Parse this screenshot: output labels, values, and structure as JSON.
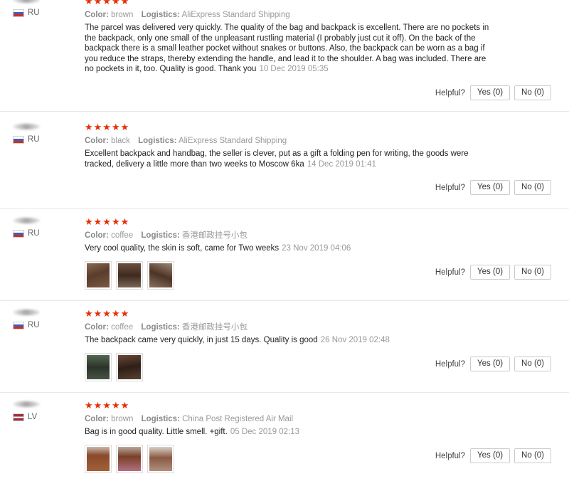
{
  "helpful_label": "Helpful?",
  "star_color": "#e62e04",
  "reviews": [
    {
      "country": "RU",
      "stars": "★★★★★",
      "color_label": "Color:",
      "color": "brown",
      "logistics_label": "Logistics:",
      "logistics": "AliExpress Standard Shipping",
      "text": "The parcel was delivered very quickly. The quality of the bag and backpack is excellent. There are no pockets in the backpack, only one small of the unpleasant rustling material (I probably just cut it off). On the back of the backpack there is a small leather pocket without snakes or buttons. Also, the backpack can be worn as a bag if you reduce the straps, thereby extending the handle, and lead it to the shoulder. A bag was included. There are no pockets in it, too. Quality is good. Thank you",
      "date": "10 Dec 2019 05:35",
      "yes": "Yes (0)",
      "no": "No (0)"
    },
    {
      "country": "RU",
      "stars": "★★★★★",
      "color_label": "Color:",
      "color": "black",
      "logistics_label": "Logistics:",
      "logistics": "AliExpress Standard Shipping",
      "text": "Excellent backpack and handbag, the seller is clever, put as a gift a folding pen for writing, the goods were tracked, delivery a little more than two weeks to Moscow 6ka",
      "date": "14 Dec 2019 01:41",
      "yes": "Yes (0)",
      "no": "No (0)"
    },
    {
      "country": "RU",
      "stars": "★★★★★",
      "color_label": "Color:",
      "color": "coffee",
      "logistics_label": "Logistics:",
      "logistics": "香港邮政挂号小包",
      "text": "Very cool quality, the skin is soft, came for Two weeks",
      "date": "23 Nov 2019 04:06",
      "yes": "Yes (0)",
      "no": "No (0)"
    },
    {
      "country": "RU",
      "stars": "★★★★★",
      "color_label": "Color:",
      "color": "coffee",
      "logistics_label": "Logistics:",
      "logistics": "香港邮政挂号小包",
      "text": "The backpack came very quickly, in just 15 days. Quality is good",
      "date": "26 Nov 2019 02:48",
      "yes": "Yes (0)",
      "no": "No (0)"
    },
    {
      "country": "LV",
      "stars": "★★★★★",
      "color_label": "Color:",
      "color": "brown",
      "logistics_label": "Logistics:",
      "logistics": "China Post Registered Air Mail",
      "text": "Bag is in good quality. Little smell. +gift.",
      "date": "05 Dec 2019 02:13",
      "yes": "Yes (0)",
      "no": "No (0)"
    }
  ]
}
